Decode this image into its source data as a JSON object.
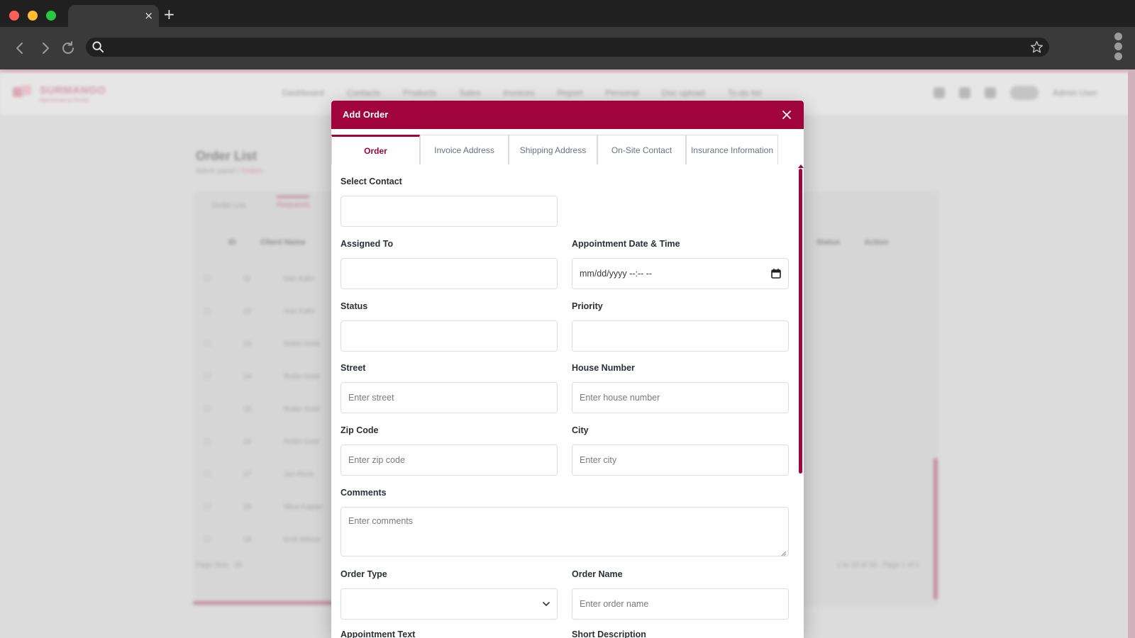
{
  "browser": {
    "tab_close": "×",
    "new_tab": "+"
  },
  "background_page": {
    "logo_text": "SURMANGO",
    "logo_sub": "Maintenance Portal",
    "nav": [
      "Dashboard",
      "Contacts",
      "Products",
      "Sales",
      "Invoices",
      "Report",
      "Personal",
      "Doc upload",
      "To-do list"
    ],
    "user_name": "Admin User",
    "page_title": "Order List",
    "breadcrumb_prefix": "Admin panel /",
    "breadcrumb_active": "Orders",
    "tabs": [
      "Order List",
      "Requests"
    ],
    "table_headers": [
      "ID",
      "Client Name",
      "Status",
      "Action"
    ],
    "rows": [
      [
        "11",
        "Ivan Kalin"
      ],
      [
        "12",
        "Ivan Kalin"
      ],
      [
        "13",
        "Robin Gold"
      ],
      [
        "14",
        "Robin Gold"
      ],
      [
        "15",
        "Robin Gold"
      ],
      [
        "16",
        "Robin Gold"
      ],
      [
        "17",
        "Jon Rock"
      ],
      [
        "18",
        "Mina Kaplan"
      ],
      [
        "19",
        "Emil Wilson"
      ]
    ],
    "footer_left": "Page Size",
    "footer_size": "20",
    "footer_right": "1 to 19 of 19 · Page 1 of 1"
  },
  "modal": {
    "title": "Add Order",
    "tabs": [
      {
        "label": "Order",
        "active": true
      },
      {
        "label": "Invoice Address",
        "active": false
      },
      {
        "label": "Shipping Address",
        "active": false
      },
      {
        "label": "On-Site Contact",
        "active": false
      },
      {
        "label": "Insurance Information",
        "active": false
      }
    ],
    "fields": {
      "select_contact": {
        "label": "Select Contact",
        "value": ""
      },
      "assigned_to": {
        "label": "Assigned To",
        "value": ""
      },
      "appointment": {
        "label": "Appointment Date & Time",
        "value": "mm/dd/yyyy --:-- --"
      },
      "status": {
        "label": "Status",
        "value": ""
      },
      "priority": {
        "label": "Priority",
        "value": ""
      },
      "street": {
        "label": "Street",
        "placeholder": "Enter street"
      },
      "house_number": {
        "label": "House Number",
        "placeholder": "Enter house number"
      },
      "zip_code": {
        "label": "Zip Code",
        "placeholder": "Enter zip code"
      },
      "city": {
        "label": "City",
        "placeholder": "Enter city"
      },
      "comments": {
        "label": "Comments",
        "placeholder": "Enter comments"
      },
      "order_type": {
        "label": "Order Type",
        "value": ""
      },
      "order_name": {
        "label": "Order Name",
        "placeholder": "Enter order name"
      },
      "appointment_text": {
        "label": "Appointment Text"
      },
      "short_description": {
        "label": "Short Description"
      }
    }
  },
  "colors": {
    "accent": "#a0043a",
    "chrome_dark": "#202020",
    "chrome_toolbar": "#3a3a3a"
  }
}
